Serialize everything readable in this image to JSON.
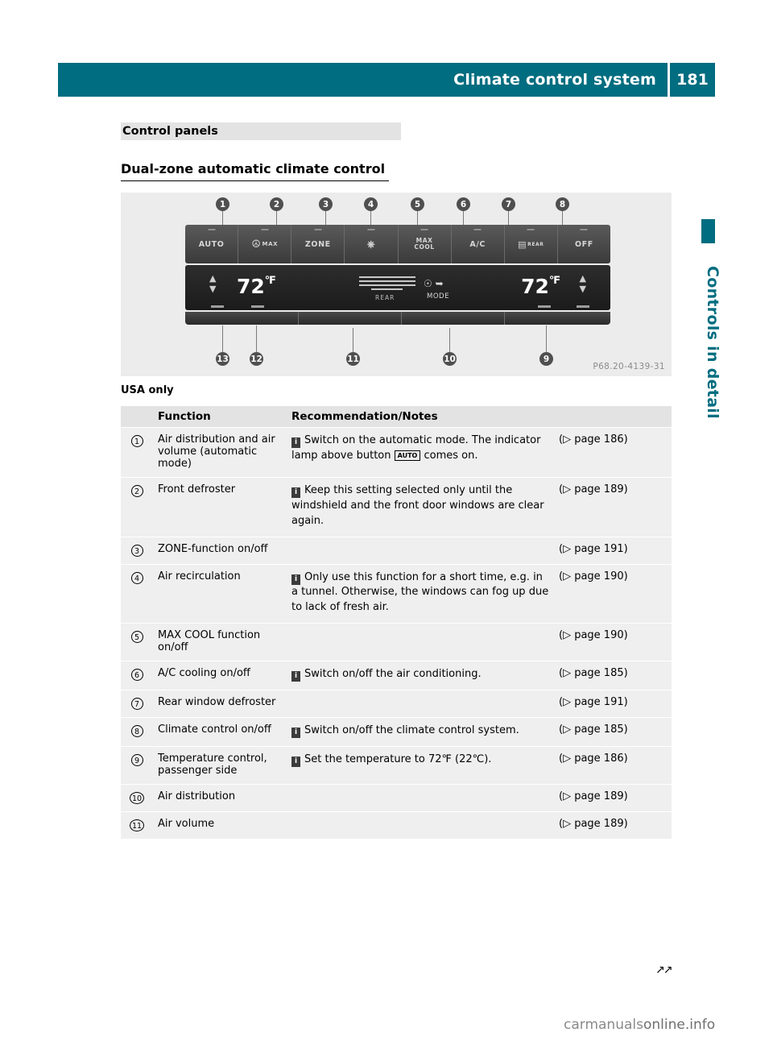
{
  "header": {
    "title": "Climate control system",
    "page_number": "181"
  },
  "side_tab": {
    "label": "Controls in detail"
  },
  "headings": {
    "h1": "Control panels",
    "h2": "Dual-zone automatic climate control"
  },
  "figure": {
    "code": "P68.20-4139-31",
    "caption": "USA only",
    "buttons": [
      "AUTO",
      "MAX",
      "ZONE",
      "",
      "MAX COOL",
      "A/C",
      "REAR",
      "OFF"
    ],
    "display": {
      "temp_left": "72",
      "temp_left_unit": "℉",
      "temp_right": "72",
      "temp_right_unit": "℉",
      "mode_label": "MODE",
      "rear_label": "REAR"
    },
    "callouts_top": [
      "1",
      "2",
      "3",
      "4",
      "5",
      "6",
      "7",
      "8"
    ],
    "callouts_bottom": [
      "13",
      "12",
      "11",
      "10",
      "9"
    ]
  },
  "table": {
    "columns": [
      "",
      "Function",
      "Recommendation/Notes",
      ""
    ],
    "rows": [
      {
        "num": "1",
        "function": "Air distribution and air volume (automatic mode)",
        "note_pre": "Switch on the automatic mode. The indicator lamp above button ",
        "note_chip": "AUTO",
        "note_post": " comes on.",
        "page": "(▷ page 186)"
      },
      {
        "num": "2",
        "function": "Front defroster",
        "note_pre": "Keep this setting selected only until the windshield and the front door windows are clear again.",
        "note_chip": "",
        "note_post": "",
        "page": "(▷ page 189)"
      },
      {
        "num": "3",
        "function": "ZONE-function on/off",
        "note_pre": "",
        "note_chip": "",
        "note_post": "",
        "page": "(▷ page 191)"
      },
      {
        "num": "4",
        "function": "Air recirculation",
        "note_pre": "Only use this function for a short time, e.g. in a tunnel. Otherwise, the windows can fog up due to lack of fresh air.",
        "note_chip": "",
        "note_post": "",
        "page": "(▷ page 190)"
      },
      {
        "num": "5",
        "function": "MAX COOL function on/off",
        "note_pre": "",
        "note_chip": "",
        "note_post": "",
        "page": "(▷ page 190)"
      },
      {
        "num": "6",
        "function": "A/C cooling on/off",
        "note_pre": "Switch on/off the air conditioning.",
        "note_chip": "",
        "note_post": "",
        "page": "(▷ page 185)"
      },
      {
        "num": "7",
        "function": "Rear window defroster",
        "note_pre": "",
        "note_chip": "",
        "note_post": "",
        "page": "(▷ page 191)"
      },
      {
        "num": "8",
        "function": "Climate control on/off",
        "note_pre": "Switch on/off the climate control system.",
        "note_chip": "",
        "note_post": "",
        "page": "(▷ page 185)"
      },
      {
        "num": "9",
        "function": "Temperature control, passenger side",
        "note_pre": "Set the temperature to 72℉ (22℃).",
        "note_chip": "",
        "note_post": "",
        "page": "(▷ page 186)"
      },
      {
        "num": "10",
        "function": "Air distribution",
        "note_pre": "",
        "note_chip": "",
        "note_post": "",
        "page": "(▷ page 189)"
      },
      {
        "num": "11",
        "function": "Air volume",
        "note_pre": "",
        "note_chip": "",
        "note_post": "",
        "page": "(▷ page 189)"
      }
    ]
  },
  "footer": {
    "continue_marker": "↗↗",
    "watermark_a": "carmanuals",
    "watermark_b": "online.info"
  },
  "colors": {
    "accent": "#006d80",
    "band": "#e3e3e3",
    "cell": "#efefef"
  }
}
